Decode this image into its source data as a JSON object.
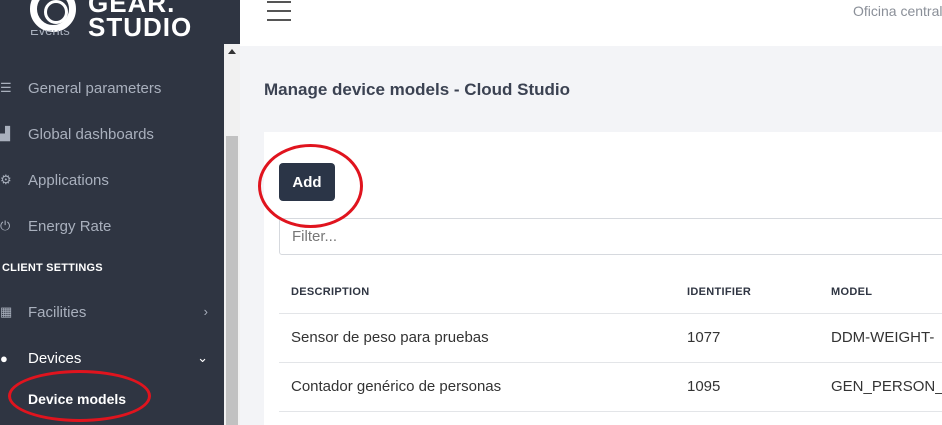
{
  "brand": {
    "line1": "GEAR.",
    "line2": "STUDIO"
  },
  "sidebar": {
    "clipped_item": "Events",
    "items": [
      {
        "label": "General parameters",
        "icon": "sliders-icon"
      },
      {
        "label": "Global dashboards",
        "icon": "bar-chart-icon"
      },
      {
        "label": "Applications",
        "icon": "cogs-icon"
      },
      {
        "label": "Energy Rate",
        "icon": "plug-icon"
      }
    ],
    "section_title": "CLIENT SETTINGS",
    "facilities": {
      "label": "Facilities",
      "icon": "building-icon"
    },
    "devices": {
      "label": "Devices",
      "icon": "lightbulb-icon"
    },
    "submenu": {
      "label": "Device models"
    }
  },
  "topbar": {
    "right_text": "Oficina central"
  },
  "page": {
    "title": "Manage device models - Cloud Studio",
    "add_label": "Add",
    "filter_placeholder": "Filter...",
    "columns": [
      "DESCRIPTION",
      "IDENTIFIER",
      "MODEL"
    ],
    "rows": [
      {
        "description": "Sensor de peso para pruebas",
        "identifier": "1077",
        "model": "DDM-WEIGHT-"
      },
      {
        "description": "Contador genérico de personas",
        "identifier": "1095",
        "model": "GEN_PERSON_"
      }
    ]
  },
  "colors": {
    "sidebar_bg": "#2f3542",
    "button_bg": "#2b3547",
    "annotation": "#e0141e"
  }
}
